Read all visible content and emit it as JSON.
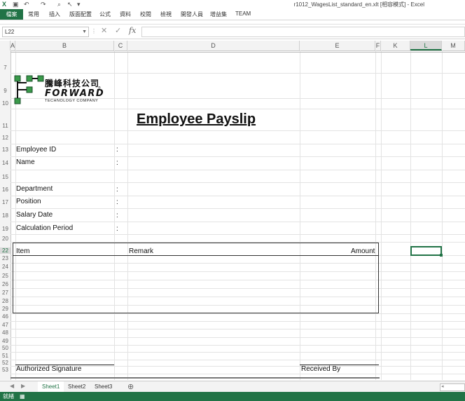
{
  "window": {
    "title": "r1012_WagesList_standard_en.xlt [相容模式] - Excel"
  },
  "ribbon": {
    "tabs": [
      "檔案",
      "常用",
      "插入",
      "版面配置",
      "公式",
      "資料",
      "校閱",
      "檢視",
      "開發人員",
      "增益集",
      "TEAM"
    ]
  },
  "formula_bar": {
    "name_box": "L22",
    "cancel": "✕",
    "enter": "✓",
    "fx": "fx",
    "value": ""
  },
  "columns": [
    "A",
    "B",
    "C",
    "D",
    "E",
    "F",
    "K",
    "L",
    "M"
  ],
  "rows": [
    "7",
    "9",
    "10",
    "11",
    "12",
    "13",
    "14",
    "15",
    "16",
    "17",
    "18",
    "19",
    "20",
    "22",
    "23",
    "24",
    "25",
    "26",
    "27",
    "28",
    "29",
    "46",
    "47",
    "48",
    "49",
    "50",
    "51",
    "52",
    "53"
  ],
  "logo": {
    "chinese": "騰峰科技公司",
    "english": "FORWARD",
    "subtitle": "TECHNOLOGY COMPANY",
    "trademark": "®"
  },
  "payslip": {
    "title": "Employee Payslip",
    "fields": [
      {
        "label": "Employee ID",
        "sep": ":"
      },
      {
        "label": "Name",
        "sep": ":"
      },
      {
        "label": "Department",
        "sep": ":"
      },
      {
        "label": "Position",
        "sep": ":"
      },
      {
        "label": "Salary Date",
        "sep": ":"
      },
      {
        "label": "Calculation Period",
        "sep": ":"
      }
    ],
    "table_headers": {
      "item": "Item",
      "remark": "Remark",
      "amount": "Amount"
    },
    "authorized_signature": "Authorized Signature",
    "received_by": "Received By"
  },
  "sheets": {
    "tabs": [
      "Sheet1",
      "Sheet2",
      "Sheet3"
    ],
    "active": "Sheet1",
    "add": "⊕"
  },
  "status": {
    "text": "就緒"
  },
  "colors": {
    "excel_green": "#217346"
  }
}
